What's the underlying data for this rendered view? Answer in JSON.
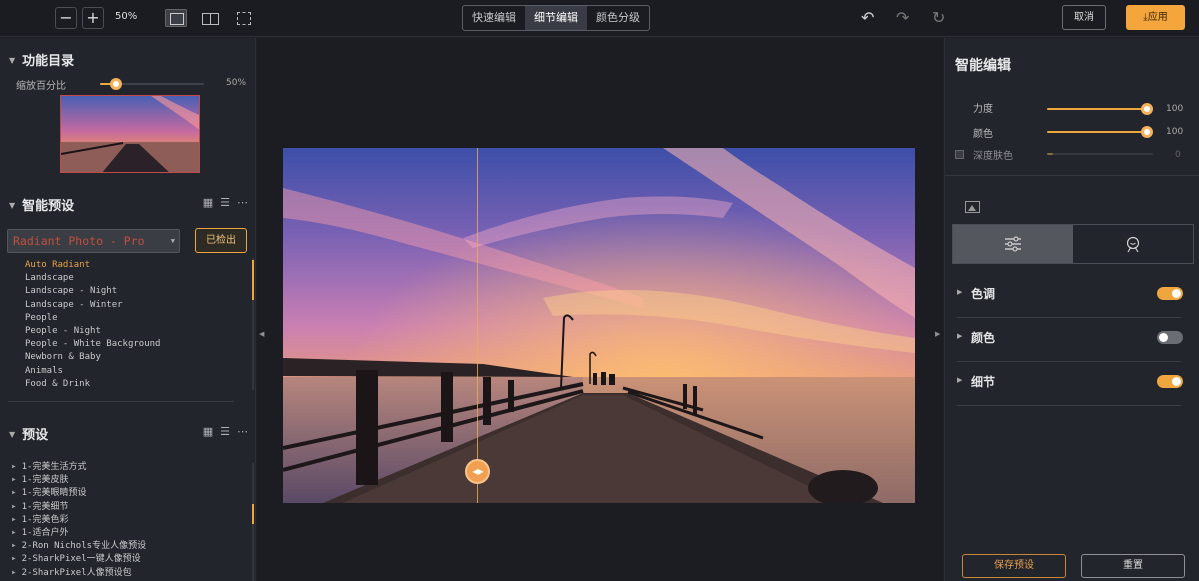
{
  "toolbar": {
    "zoom_out": "−",
    "zoom_in": "+",
    "zoom_level": "50%",
    "mode_tabs": [
      {
        "label": "快速编辑"
      },
      {
        "label": "细节编辑"
      },
      {
        "label": "颜色分级"
      }
    ],
    "undo_icon": "↶",
    "redo_icon": "↷",
    "reset_icon": "↻",
    "cancel_label": "取消",
    "apply_label": "⤓应用"
  },
  "left": {
    "catalog_title": "功能目录",
    "scale_label": "缩放百分比",
    "scale_value": "50%",
    "scale_level": 0.15,
    "smart_presets_title": "智能预设",
    "selected_preset": "Radiant Photo - Pro",
    "detected_label": "已检出",
    "preset_items": [
      "Auto Radiant",
      "Landscape",
      "Landscape - Night",
      "Landscape - Winter",
      "People",
      "People - Night",
      "People - White Background",
      "Newborn & Baby",
      "Animals",
      "Food & Drink"
    ],
    "presets_title": "预设",
    "preset_folders": [
      "1-完美生活方式",
      "1-完美皮肤",
      "1-完美眼睛预设",
      "1-完美细节",
      "1-完美色彩",
      "1-适合户外",
      "2-Ron Nichols专业人像预设",
      "2-SharkPixel一键人像预设",
      "2-SharkPixel人像预设包"
    ]
  },
  "right": {
    "title": "智能编辑",
    "strength_label": "力度",
    "strength_value": "100",
    "strength_level": 1.0,
    "color_label": "颜色",
    "color_value": "100",
    "color_level": 1.0,
    "skin_label": "深度肤色",
    "skin_value": "0",
    "skin_level": 0.0,
    "sections": [
      {
        "label": "色调",
        "enabled": true
      },
      {
        "label": "颜色",
        "enabled": false
      },
      {
        "label": "细节",
        "enabled": true
      }
    ],
    "save_label": "保存预设",
    "reset_label": "重置"
  },
  "colors": {
    "accent": "#f0a63e",
    "panel": "#22252b",
    "canvas": "#1b1d22"
  }
}
